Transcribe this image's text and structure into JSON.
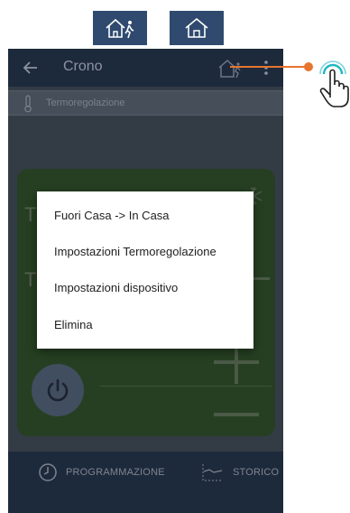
{
  "legend": {
    "icons": [
      "home-away-icon",
      "home-icon"
    ]
  },
  "appbar": {
    "back_icon": "arrow-left-icon",
    "title": "Crono",
    "action_icon": "home-away-icon",
    "more_icon": "more-vert-icon"
  },
  "section": {
    "icon": "thermometer-icon",
    "label": "Termoregolazione"
  },
  "background_panel": {
    "glyph_left_1": "T",
    "glyph_left_2": "T",
    "snow_icon": "snowflake-icon",
    "power_icon": "power-icon"
  },
  "menu": {
    "items": [
      {
        "label": "Fuori Casa -> In Casa"
      },
      {
        "label": "Impostazioni Termoregolazione"
      },
      {
        "label": "Impostazioni dispositivo"
      },
      {
        "label": "Elimina"
      }
    ]
  },
  "bottom_nav": {
    "tabs": [
      {
        "icon": "clock-icon",
        "label": "PROGRAMMAZIONE"
      },
      {
        "icon": "history-chart-icon",
        "label": "STORICO"
      }
    ]
  },
  "colors": {
    "accent_orange": "#e8742e",
    "teal": "#1fb7c4",
    "appbar": "#1d2a3c",
    "card_green": "#263f22"
  }
}
